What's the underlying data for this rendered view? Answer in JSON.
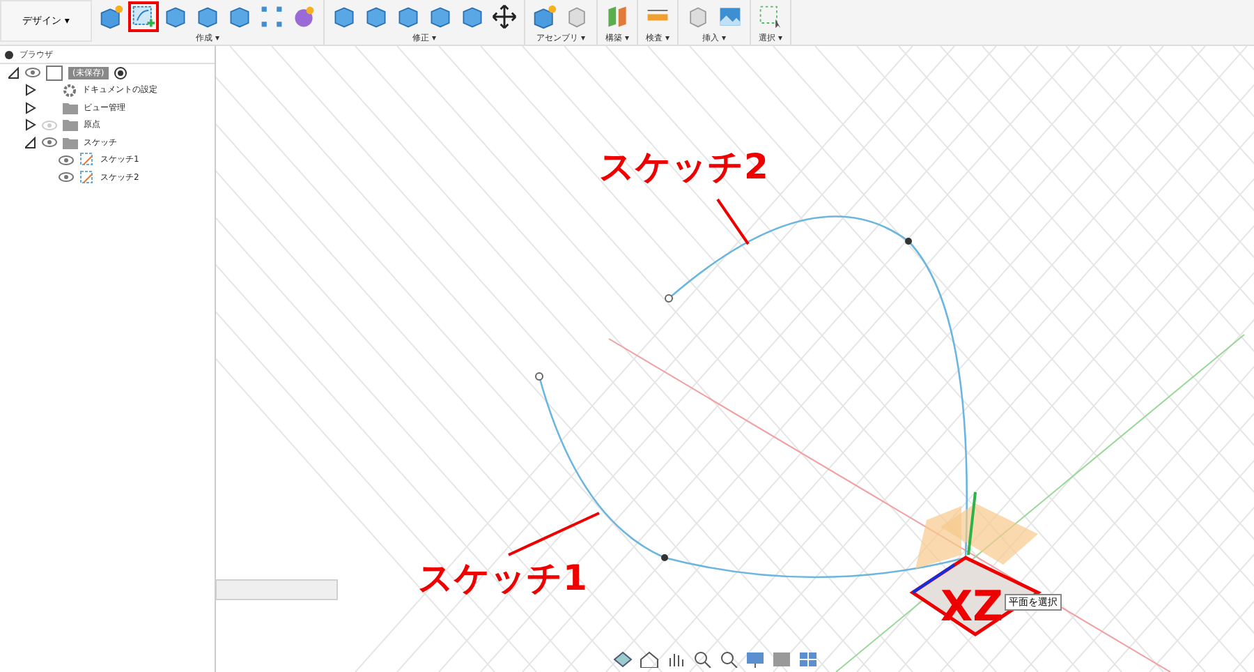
{
  "workspace_button": {
    "label": "デザイン",
    "caret": "▾"
  },
  "toolbar_groups": [
    {
      "label": "作成 ▾",
      "tools": [
        {
          "kind": "box-spark",
          "selected": false
        },
        {
          "kind": "sketch",
          "selected": true
        },
        {
          "kind": "extrude",
          "selected": false
        },
        {
          "kind": "revolve",
          "selected": false
        },
        {
          "kind": "hole",
          "selected": false
        },
        {
          "kind": "pattern",
          "selected": false
        },
        {
          "kind": "form",
          "selected": false
        }
      ]
    },
    {
      "label": "修正 ▾",
      "tools": [
        {
          "kind": "press",
          "selected": false
        },
        {
          "kind": "fillet",
          "selected": false
        },
        {
          "kind": "shell",
          "selected": false
        },
        {
          "kind": "combine",
          "selected": false
        },
        {
          "kind": "plane-cut",
          "selected": false
        },
        {
          "kind": "move",
          "selected": false
        }
      ]
    },
    {
      "label": "アセンブリ ▾",
      "tools": [
        {
          "kind": "box-spark",
          "selected": false
        },
        {
          "kind": "joint",
          "selected": false
        }
      ]
    },
    {
      "label": "構築 ▾",
      "tools": [
        {
          "kind": "planes",
          "selected": false
        }
      ]
    },
    {
      "label": "検査 ▾",
      "tools": [
        {
          "kind": "measure",
          "selected": false
        }
      ]
    },
    {
      "label": "挿入 ▾",
      "tools": [
        {
          "kind": "insert",
          "selected": false
        },
        {
          "kind": "image",
          "selected": false
        }
      ]
    },
    {
      "label": "選択 ▾",
      "tools": [
        {
          "kind": "select",
          "selected": false
        }
      ]
    }
  ],
  "browser": {
    "title": "ブラウザ",
    "tree": [
      {
        "label": "(未保存)",
        "kind": "component",
        "expanded": true,
        "visible": true,
        "children": [
          {
            "label": "ドキュメントの設定",
            "kind": "settings",
            "expanded": false
          },
          {
            "label": "ビュー管理",
            "kind": "folder",
            "expanded": false
          },
          {
            "label": "原点",
            "kind": "folder",
            "expanded": false,
            "visible": false
          },
          {
            "label": "スケッチ",
            "kind": "folder",
            "expanded": true,
            "visible": true,
            "children": [
              {
                "label": "スケッチ1",
                "kind": "sketch",
                "visible": true
              },
              {
                "label": "スケッチ2",
                "kind": "sketch",
                "visible": true
              }
            ]
          }
        ]
      }
    ]
  },
  "viewport": {
    "annotations": [
      {
        "text": "スケッチ2",
        "kind": "upper"
      },
      {
        "text": "スケッチ1",
        "kind": "lower"
      }
    ],
    "plane_label": "XZ",
    "tooltip": "平面を選択"
  }
}
